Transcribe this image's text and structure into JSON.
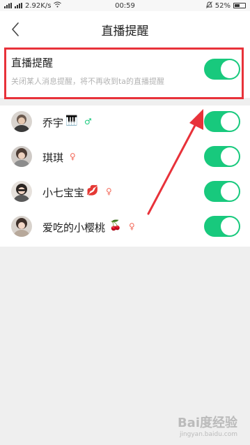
{
  "status_bar": {
    "network_speed": "2.92K/s",
    "time": "00:59",
    "battery": "52%"
  },
  "header": {
    "title": "直播提醒"
  },
  "master_setting": {
    "label": "直播提醒",
    "description": "关闭某人消息提醒，将不再收到ta的直播提醒",
    "enabled": true
  },
  "users": [
    {
      "name": "乔宇",
      "badge": "🎹",
      "gender_symbol": "♂",
      "gender_color": "#18c97d",
      "toggle_on": true
    },
    {
      "name": "琪琪",
      "badge": "",
      "gender_symbol": "♀",
      "gender_color": "#f36a5a",
      "toggle_on": true
    },
    {
      "name": "小七宝宝",
      "badge": "💋",
      "gender_symbol": "♀",
      "gender_color": "#f36a5a",
      "toggle_on": true
    },
    {
      "name": "爱吃的小樱桃",
      "badge": "🍒",
      "gender_symbol": "♀",
      "gender_color": "#f36a5a",
      "toggle_on": true
    }
  ],
  "colors": {
    "accent_green": "#18c97d",
    "highlight_red": "#e8323a"
  },
  "watermark": {
    "brand": "Bai度经验",
    "url": "jingyan.baidu.com"
  }
}
